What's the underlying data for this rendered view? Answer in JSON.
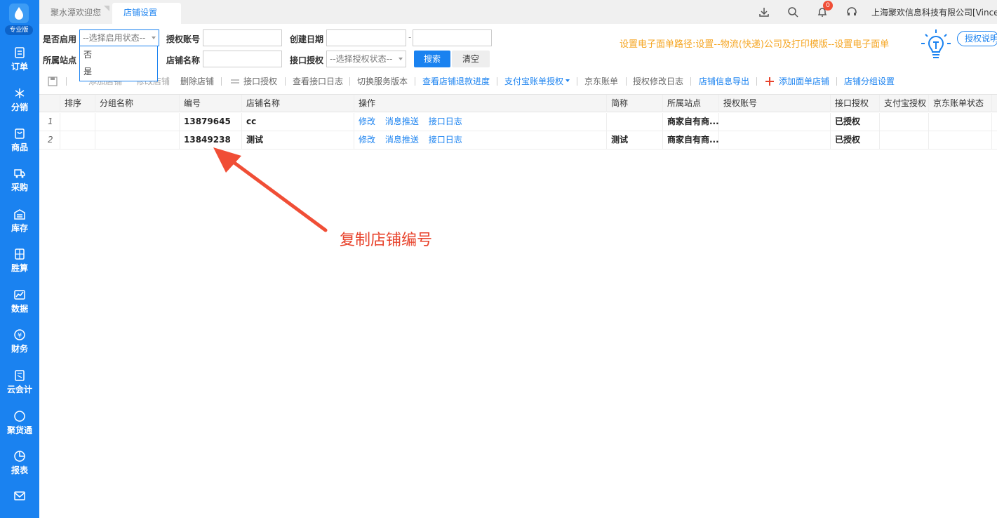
{
  "sidebar": {
    "logo_badge": "专业版",
    "items": [
      {
        "label": "订单",
        "icon": "document-icon"
      },
      {
        "label": "分销",
        "icon": "snowflake-icon"
      },
      {
        "label": "商品",
        "icon": "bag-icon"
      },
      {
        "label": "采购",
        "icon": "truck-icon"
      },
      {
        "label": "库存",
        "icon": "warehouse-icon"
      },
      {
        "label": "胜算",
        "icon": "calculator-icon"
      },
      {
        "label": "数据",
        "icon": "chart-icon"
      },
      {
        "label": "财务",
        "icon": "yen-coin-icon"
      },
      {
        "label": "云会计",
        "icon": "ledger-icon"
      },
      {
        "label": "聚货通",
        "icon": "circle-icon"
      },
      {
        "label": "报表",
        "icon": "pie-icon"
      }
    ]
  },
  "tabs": [
    {
      "label": "聚水潭欢迎您",
      "active": false
    },
    {
      "label": "店铺设置",
      "active": true
    }
  ],
  "header": {
    "notification_count": "0",
    "company": "上海聚欢信息科技有限公司[Vince"
  },
  "filters": {
    "enable_label": "是否启用",
    "enable_placeholder": "--选择启用状态--",
    "enable_options": [
      "否",
      "是"
    ],
    "auth_account_label": "授权账号",
    "create_date_label": "创建日期",
    "date_sep": "-",
    "site_label": "所属站点",
    "shop_name_label": "店铺名称",
    "api_auth_label": "接口授权",
    "api_auth_placeholder": "--选择授权状态--",
    "search_btn": "搜索",
    "clear_btn": "清空"
  },
  "hint": "设置电子面单路径:设置--物流(快递)公司及打印模版--设置电子面单",
  "auth_help": "授权说明",
  "toolbar": {
    "add_shop": "添加店铺",
    "edit_shop": "修改店铺",
    "delete_shop": "删除店铺",
    "api_auth": "接口授权",
    "view_api_log": "查看接口日志",
    "switch_version": "切换服务版本",
    "refund_progress": "查看店铺退款进度",
    "alipay_auth": "支付宝账单授权",
    "jd_bill": "京东账单",
    "auth_log": "授权修改日志",
    "export": "店铺信息导出",
    "add_waybill_shop": "添加面单店铺",
    "group_settings": "店铺分组设置"
  },
  "table": {
    "headers": [
      "排序",
      "分组名称",
      "编号",
      "店铺名称",
      "操作",
      "简称",
      "所属站点",
      "授权账号",
      "接口授权",
      "支付宝授权",
      "京东账单状态"
    ],
    "op_links": [
      "修改",
      "消息推送",
      "接口日志"
    ],
    "rows": [
      {
        "num": "1",
        "order": "",
        "group": "",
        "id": "13879645",
        "name": "cc",
        "short": "",
        "site": "商家自有商...",
        "account": "",
        "api": "已授权",
        "alipay": "",
        "jd": ""
      },
      {
        "num": "2",
        "order": "",
        "group": "",
        "id": "13849238",
        "name": "测试",
        "short": "测试",
        "site": "商家自有商...",
        "account": "",
        "api": "已授权",
        "alipay": "",
        "jd": ""
      }
    ]
  },
  "annotation": "复制店铺编号"
}
